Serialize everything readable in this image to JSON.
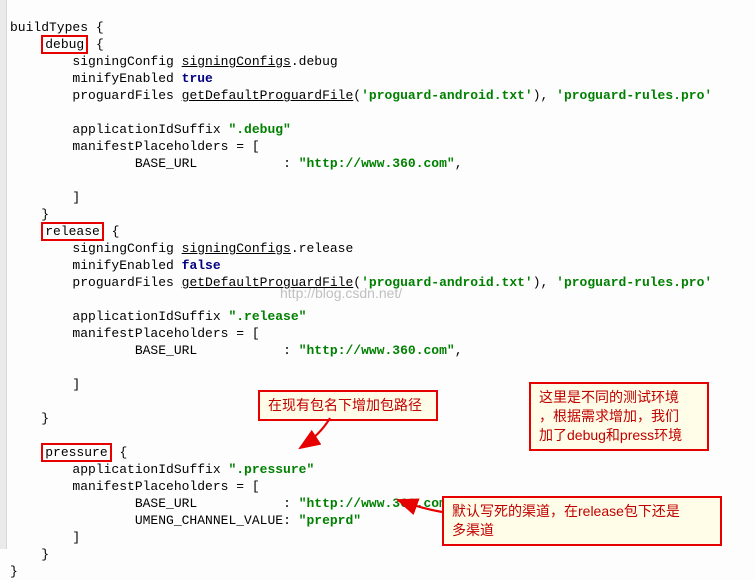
{
  "code": {
    "buildTypes": "buildTypes",
    "lbrace": "{",
    "rbrace": "}",
    "rbracket": "]",
    "debug_name": "debug",
    "signingConfig1": "signingConfig ",
    "signingConfigs_u": "signingConfigs",
    "dot_debug": ".debug",
    "minifyEnabled": "minifyEnabled ",
    "true": "true",
    "false": "false",
    "proguardFiles": "proguardFiles ",
    "getDefaultProguardFile": "getDefaultProguardFile",
    "proguard_android": "'proguard-android.txt'",
    "proguard_rules": "'proguard-rules.pro'",
    "appIdSuffix": "applicationIdSuffix ",
    "suffix_debug": "\".debug\"",
    "manifestPlaceholders": "manifestPlaceholders = [",
    "base_url_key": "BASE_URL",
    "colon": ": ",
    "base_url_val": "\"http://www.360.com\"",
    "comma": ",",
    "release_name": "release",
    "dot_release": ".release",
    "suffix_release": "\".release\"",
    "pressure_name": "pressure",
    "suffix_pressure": "\".pressure\"",
    "umeng_key": "UMENG_CHANNEL_VALUE",
    "preprd": "\"preprd\""
  },
  "watermark": "http://blog.csdn.net/",
  "callouts": {
    "c1": "在现有包名下增加包路径",
    "c2_l1": "这里是不同的测试环境",
    "c2_l2": "，根据需求增加，我们",
    "c2_l3": "加了debug和press环境",
    "c3_l1": "默认写死的渠道，在release包下还是",
    "c3_l2": "多渠道"
  }
}
